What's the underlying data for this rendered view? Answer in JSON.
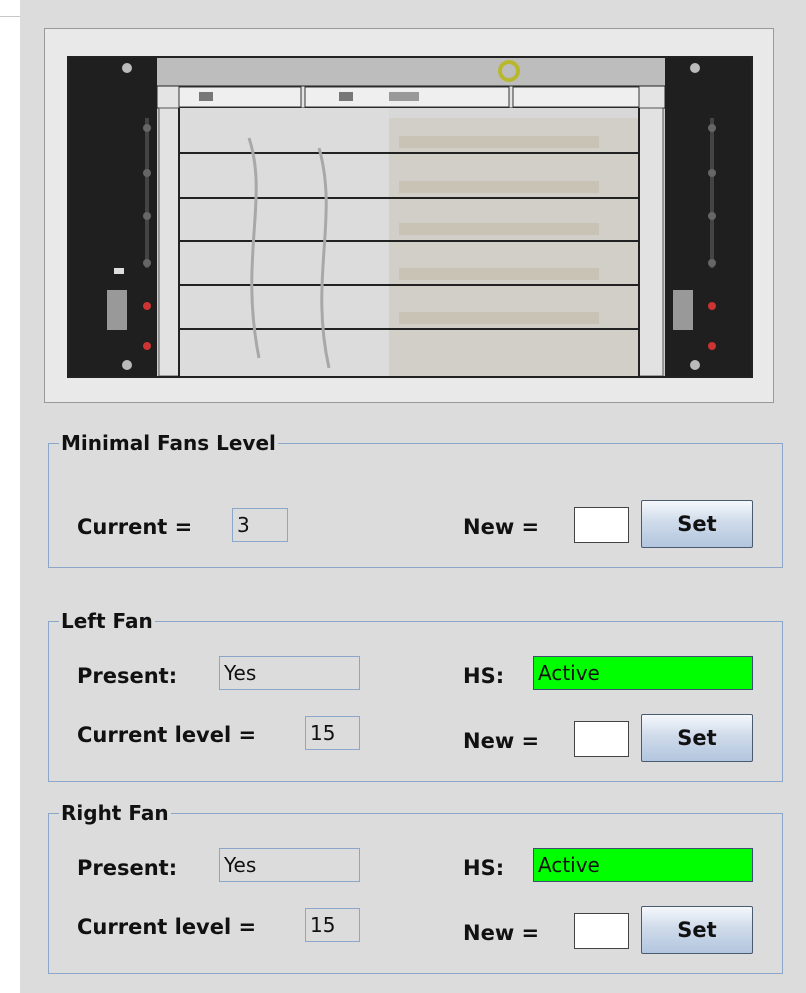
{
  "minimal_fans": {
    "title": "Minimal Fans Level",
    "current_label": "Current =",
    "current_value": "3",
    "new_label": "New =",
    "new_value": "",
    "set_label": "Set"
  },
  "left_fan": {
    "title": "Left Fan",
    "present_label": "Present:",
    "present_value": "Yes",
    "hs_label": "HS:",
    "hs_value": "Active",
    "level_label": "Current level =",
    "level_value": "15",
    "new_label": "New =",
    "new_value": "",
    "set_label": "Set"
  },
  "right_fan": {
    "title": "Right Fan",
    "present_label": "Present:",
    "present_value": "Yes",
    "hs_label": "HS:",
    "hs_value": "Active",
    "level_label": "Current level =",
    "level_value": "15",
    "new_label": "New =",
    "new_value": "",
    "set_label": "Set"
  },
  "colors": {
    "status_active": "#00ff00",
    "panel_bg": "#dcdcdc",
    "border_blue": "#8aa6c8"
  }
}
